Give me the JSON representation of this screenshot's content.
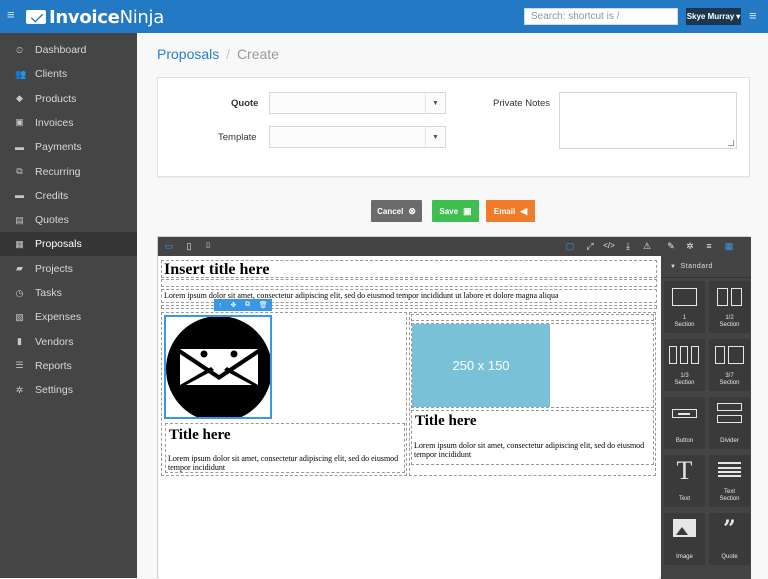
{
  "topbar": {
    "brand_bold": "Invoice",
    "brand_light": "Ninja",
    "search_placeholder": "Search: shortcut is /",
    "user_name": "Skye Murray",
    "user_caret": "▾"
  },
  "sidebar": {
    "items": [
      {
        "label": "Dashboard",
        "icon": "tachometer-icon",
        "glyph": "⏲"
      },
      {
        "label": "Clients",
        "icon": "users-icon",
        "glyph": "👥"
      },
      {
        "label": "Products",
        "icon": "cube-icon",
        "glyph": "◆"
      },
      {
        "label": "Invoices",
        "icon": "file-pdf-icon",
        "glyph": "▣"
      },
      {
        "label": "Payments",
        "icon": "credit-card-icon",
        "glyph": "▬"
      },
      {
        "label": "Recurring",
        "icon": "files-icon",
        "glyph": "⧉"
      },
      {
        "label": "Credits",
        "icon": "credit-card-icon",
        "glyph": "▬"
      },
      {
        "label": "Quotes",
        "icon": "file-text-icon",
        "glyph": "▤"
      },
      {
        "label": "Proposals",
        "icon": "th-large-icon",
        "glyph": "▦"
      },
      {
        "label": "Projects",
        "icon": "briefcase-icon",
        "glyph": "▰"
      },
      {
        "label": "Tasks",
        "icon": "clock-icon",
        "glyph": "◷"
      },
      {
        "label": "Expenses",
        "icon": "file-image-icon",
        "glyph": "▧"
      },
      {
        "label": "Vendors",
        "icon": "building-icon",
        "glyph": "▮"
      },
      {
        "label": "Reports",
        "icon": "th-list-icon",
        "glyph": "☰"
      },
      {
        "label": "Settings",
        "icon": "cog-icon",
        "glyph": "✲"
      }
    ],
    "active_index": 8
  },
  "breadcrumb": {
    "parent": "Proposals",
    "separator": "/",
    "current": "Create"
  },
  "form": {
    "quote_label": "Quote",
    "quote_value": "",
    "template_label": "Template",
    "template_value": "",
    "notes_label": "Private Notes",
    "notes_value": ""
  },
  "actions": {
    "cancel": "Cancel",
    "save": "Save",
    "email": "Email",
    "cancel_color": "#6b6b6b",
    "save_color": "#3fbf4f",
    "email_color": "#f07b2a"
  },
  "editor": {
    "title_block": "Insert title here",
    "lorem_long": "Lorem ipsum dolor sit amet, consectetur adipiscing elit, sed do eiusmod tempor incididunt ut labore et dolore magna aliqua",
    "col1_title": "Title here",
    "col1_text": "Lorem ipsum dolor sit amet, consectetur adipiscing elit, sed do eiusmod tempor incididunt",
    "placeholder_image": "250 x 150",
    "col2_title": "Title here",
    "col2_text": "Lorem ipsum dolor sit amet, consectetur adipiscing elit, sed do eiusmod tempor incididunt",
    "placeholder_color": "#79c1d6"
  },
  "blocks": {
    "category": "Standard",
    "items": [
      {
        "label": "1\nSection",
        "icon": "one-section-icon"
      },
      {
        "label": "1/2\nSection",
        "icon": "two-section-icon"
      },
      {
        "label": "1/3\nSection",
        "icon": "three-section-icon"
      },
      {
        "label": "3/7\nSection",
        "icon": "three-seven-section-icon"
      },
      {
        "label": "Button",
        "icon": "button-block-icon"
      },
      {
        "label": "Divider",
        "icon": "divider-icon"
      },
      {
        "label": "Text",
        "icon": "text-icon"
      },
      {
        "label": "Text\nSection",
        "icon": "text-section-icon"
      },
      {
        "label": "Image",
        "icon": "image-icon"
      },
      {
        "label": "Quote",
        "icon": "quote-icon"
      }
    ]
  }
}
